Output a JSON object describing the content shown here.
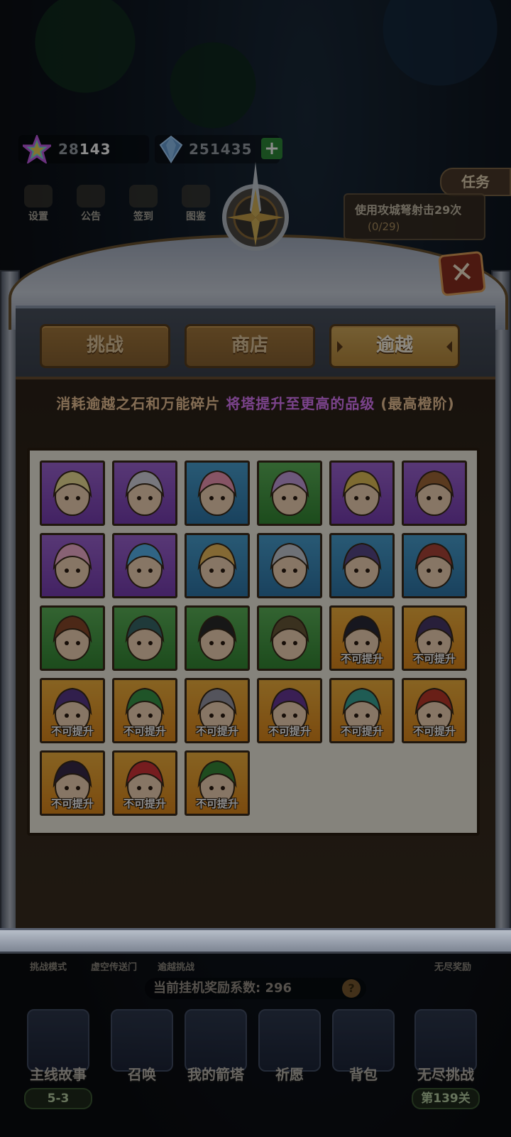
{
  "resources": {
    "stars": {
      "value_back": "28",
      "value": "143",
      "icon": "star-icon"
    },
    "gems": {
      "value": "251435",
      "icon": "gem-icon",
      "add": "+"
    }
  },
  "menu": [
    {
      "label": "设置",
      "icon": "gear-icon"
    },
    {
      "label": "公告",
      "icon": "notice-icon"
    },
    {
      "label": "签到",
      "icon": "scroll-icon"
    },
    {
      "label": "图鉴",
      "icon": "book-icon"
    }
  ],
  "task": {
    "tab": "任务",
    "text": "使用攻城弩射击29次",
    "progress": "(0/29)"
  },
  "close": "✕",
  "tabs": [
    {
      "label": "挑战",
      "active": false
    },
    {
      "label": "商店",
      "active": false
    },
    {
      "label": "逾越",
      "active": true
    }
  ],
  "description": {
    "part1": "消耗逾越之石和万能碎片",
    "part2": "将塔提升至更高的品级",
    "part3": "(最高橙阶)"
  },
  "locked_label": "不可提升",
  "heroes": [
    {
      "rarity": "purple",
      "locked": false,
      "icon": "ice-princess-icon",
      "color": "#f2e39a"
    },
    {
      "rarity": "purple",
      "locked": false,
      "icon": "cat-gunner-icon",
      "color": "#d9d9e3"
    },
    {
      "rarity": "blue",
      "locked": false,
      "icon": "pirate-girl-icon",
      "color": "#f49ab8"
    },
    {
      "rarity": "green",
      "locked": false,
      "icon": "fire-witch-icon",
      "color": "#c7a0e0"
    },
    {
      "rarity": "purple",
      "locked": false,
      "icon": "egypt-priestess-icon",
      "color": "#e5c35a"
    },
    {
      "rarity": "purple",
      "locked": false,
      "icon": "crowned-queen-icon",
      "color": "#a56a3a"
    },
    {
      "rarity": "purple",
      "locked": false,
      "icon": "flower-fairy-icon",
      "color": "#f7b3d4"
    },
    {
      "rarity": "purple",
      "locked": false,
      "icon": "ice-dragon-icon",
      "color": "#58b6f0"
    },
    {
      "rarity": "blue",
      "locked": false,
      "icon": "angel-archer-icon",
      "color": "#f0c060"
    },
    {
      "rarity": "blue",
      "locked": false,
      "icon": "silver-knight-icon",
      "color": "#c9ced8"
    },
    {
      "rarity": "blue",
      "locked": false,
      "icon": "shadow-mage-icon",
      "color": "#5a4a8a"
    },
    {
      "rarity": "blue",
      "locked": false,
      "icon": "bearded-engineer-icon",
      "color": "#b0453a"
    },
    {
      "rarity": "green",
      "locked": false,
      "icon": "elf-ranger-icon",
      "color": "#8a4a2a"
    },
    {
      "rarity": "green",
      "locked": false,
      "icon": "old-wizard-icon",
      "color": "#3a6a6a"
    },
    {
      "rarity": "green",
      "locked": false,
      "icon": "ninja-icon",
      "color": "#2a2a2a"
    },
    {
      "rarity": "green",
      "locked": false,
      "icon": "stone-golem-icon",
      "color": "#6a5a3a"
    },
    {
      "rarity": "orange",
      "locked": true,
      "icon": "samurai-lady-icon",
      "color": "#2a2a3a"
    },
    {
      "rarity": "orange",
      "locked": true,
      "icon": "griffin-icon",
      "color": "#4a3a6a"
    },
    {
      "rarity": "orange",
      "locked": true,
      "icon": "hammer-dwarf-icon",
      "color": "#5a3a8a"
    },
    {
      "rarity": "orange",
      "locked": true,
      "icon": "medusa-icon",
      "color": "#3a9a4a"
    },
    {
      "rarity": "orange",
      "locked": true,
      "icon": "viking-warrior-icon",
      "color": "#9a9aa8"
    },
    {
      "rarity": "orange",
      "locked": true,
      "icon": "purple-wizard-icon",
      "color": "#6a3a9a"
    },
    {
      "rarity": "orange",
      "locked": true,
      "icon": "tribal-shaman-icon",
      "color": "#3aa89a"
    },
    {
      "rarity": "orange",
      "locked": true,
      "icon": "spartan-icon",
      "color": "#c0392b"
    },
    {
      "rarity": "orange",
      "locked": true,
      "icon": "fire-demon-icon",
      "color": "#3a2a4a"
    },
    {
      "rarity": "orange",
      "locked": true,
      "icon": "red-hair-brute-icon",
      "color": "#d8353a"
    },
    {
      "rarity": "orange",
      "locked": true,
      "icon": "robin-hood-icon",
      "color": "#3a8a3a"
    }
  ],
  "modes": [
    {
      "label": "挑战模式"
    },
    {
      "label": "虚空传送门"
    },
    {
      "label": "逾越挑战"
    },
    {
      "label": "无尽奖励"
    }
  ],
  "reward": {
    "text": "当前挂机奖励系数: 296",
    "help": "?"
  },
  "nav": [
    {
      "label": "主线故事",
      "sub": "5-3",
      "icon": "book-icon"
    },
    {
      "label": "召唤",
      "sub": "",
      "icon": "scroll-icon"
    },
    {
      "label": "我的箭塔",
      "sub": "",
      "icon": "tower-icon"
    },
    {
      "label": "祈愿",
      "sub": "",
      "icon": "star-icon"
    },
    {
      "label": "背包",
      "sub": "",
      "icon": "backpack-icon"
    },
    {
      "label": "无尽挑战",
      "sub": "第139关",
      "icon": "winged-sword-icon"
    }
  ]
}
